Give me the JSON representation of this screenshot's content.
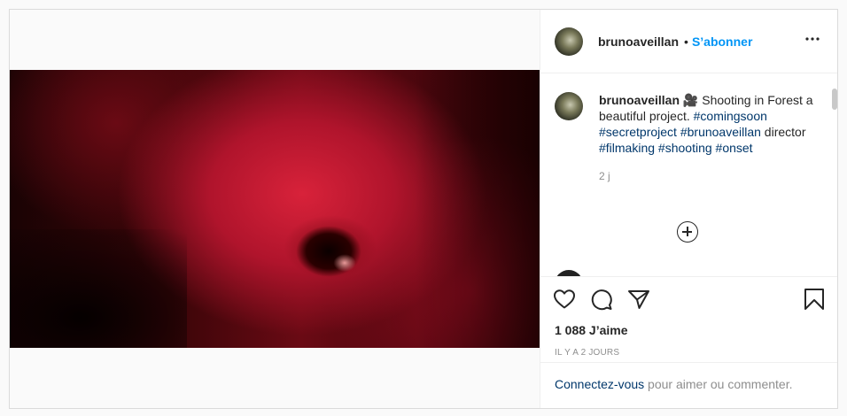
{
  "post": {
    "username": "brunoaveillan",
    "follow_separator": "•",
    "follow_label": "S’abonner",
    "more_label": "•••",
    "caption": {
      "username": "brunoaveillan",
      "emoji": "🎥",
      "text_before_tags": " Shooting in Forest a beautiful project. ",
      "tags1": [
        "#comingsoon",
        "#secretproject",
        "#brunoaveillan"
      ],
      "middle_text": " director ",
      "tags2": [
        "#filmaking",
        "#shooting",
        "#onset"
      ]
    },
    "time": "2 j",
    "likes": "1 088 J’aime",
    "posted_ago": "IL Y A 2 JOURS",
    "footer": {
      "login_label": "Connectez-vous",
      "rest": " pour aimer ou commenter."
    }
  },
  "icons": {
    "like": "heart-icon",
    "comment": "comment-icon",
    "share": "paper-plane-icon",
    "save": "bookmark-icon",
    "load_more": "plus-circle-icon",
    "options": "more-horizontal-icon"
  },
  "colors": {
    "accent": "#0095f6",
    "hashtag": "#00376b",
    "muted": "#8e8e8e",
    "photo_tint": "#d8223a"
  }
}
